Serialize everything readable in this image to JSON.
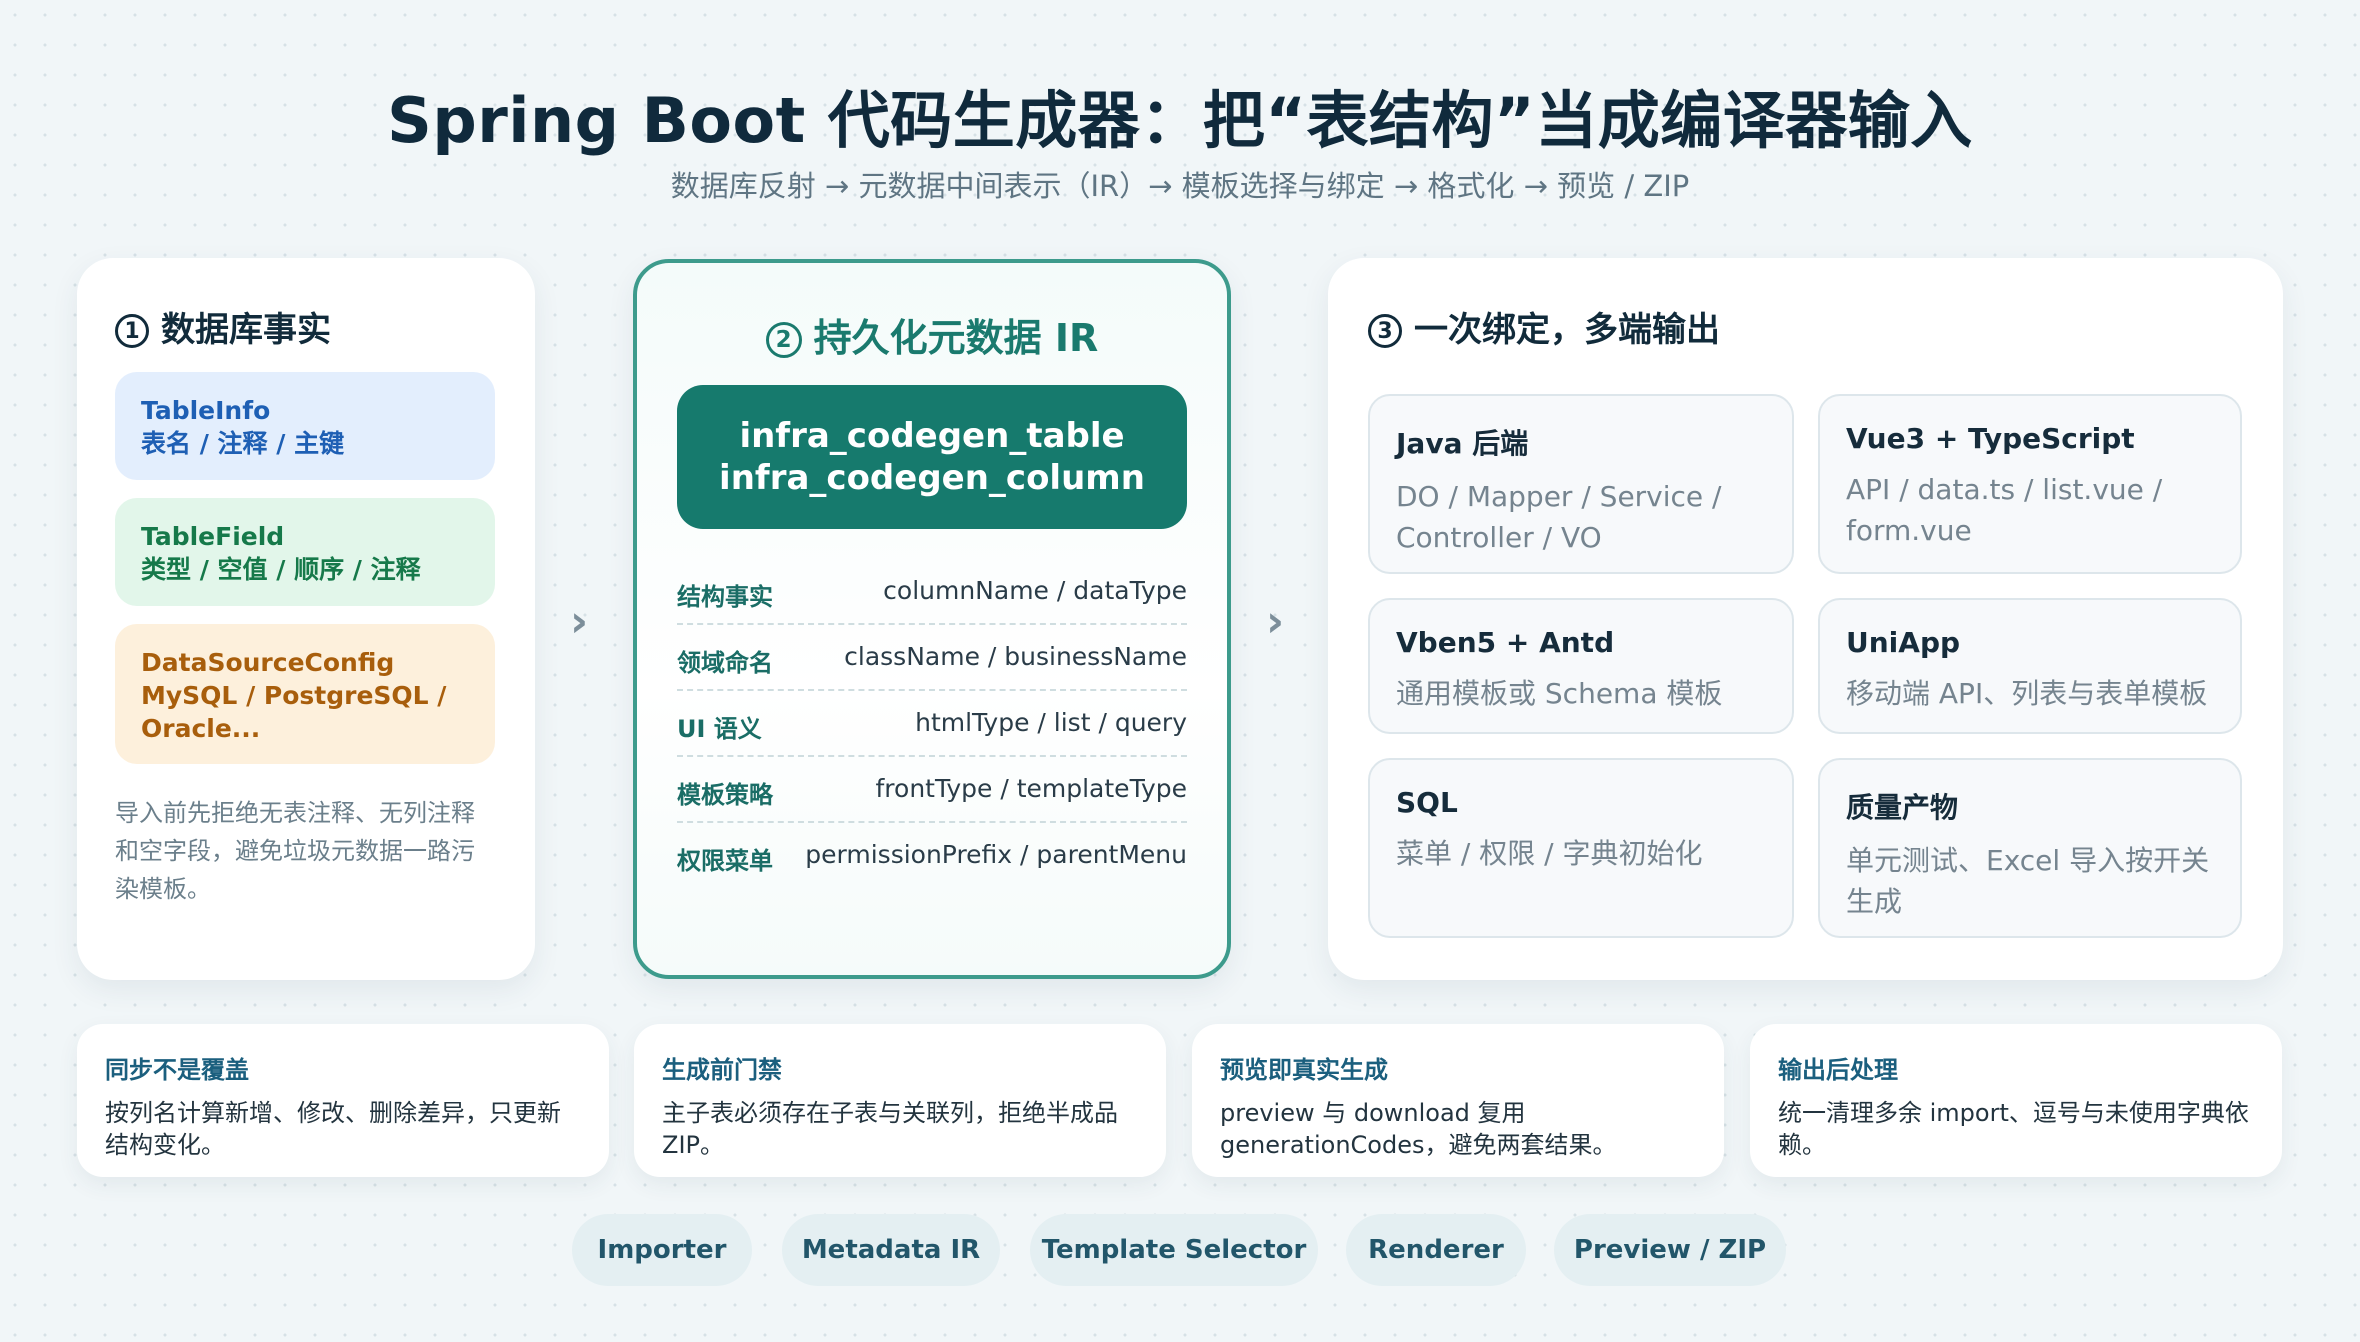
{
  "header": {
    "title": "Spring Boot 代码生成器：把“表结构”当成编译器输入",
    "subtitle": "数据库反射 → 元数据中间表示（IR）→ 模板选择与绑定 → 格式化 → 预览 / ZIP"
  },
  "left": {
    "num": "1",
    "title": "数据库事实",
    "pills": [
      {
        "line1": "TableInfo",
        "line2": "表名 / 注释 / 主键"
      },
      {
        "line1": "TableField",
        "line2": "类型 / 空值 / 顺序 / 注释"
      },
      {
        "line1": "DataSourceConfig",
        "line2": "MySQL / PostgreSQL /",
        "line3": "Oracle..."
      }
    ],
    "note": "导入前先拒绝无表注释、无列注释和空字段，避免垃圾元数据一路污染模板。"
  },
  "arrows": {
    "a1": "›",
    "a2": "›"
  },
  "middle": {
    "num": "2",
    "title": "持久化元数据 IR",
    "banner_line1": "infra_codegen_table",
    "banner_line2": "infra_codegen_column",
    "rows": [
      {
        "key": "结构事实",
        "value": "columnName / dataType"
      },
      {
        "key": "领域命名",
        "value": "className / businessName"
      },
      {
        "key": "UI 语义",
        "value": "htmlType / list / query"
      },
      {
        "key": "模板策略",
        "value": "frontType / templateType"
      },
      {
        "key": "权限菜单",
        "value": "permissionPrefix / parentMenu"
      }
    ]
  },
  "right": {
    "num": "3",
    "title": "一次绑定，多端输出",
    "tiles": [
      {
        "title": "Java 后端",
        "desc": "DO / Mapper / Service / Controller / VO"
      },
      {
        "title": "Vue3 + TypeScript",
        "desc": "API / data.ts / list.vue / form.vue"
      },
      {
        "title": "Vben5 + Antd",
        "desc": "通用模板或 Schema 模板"
      },
      {
        "title": "UniApp",
        "desc": "移动端 API、列表与表单模板"
      },
      {
        "title": "SQL",
        "desc": "菜单 / 权限 / 字典初始化"
      },
      {
        "title": "质量产物",
        "desc": "单元测试、Excel 导入按开关生成"
      }
    ]
  },
  "footer_cards": [
    {
      "title": "同步不是覆盖",
      "desc": "按列名计算新增、修改、删除差异，只更新结构变化。"
    },
    {
      "title": "生成前门禁",
      "desc": "主子表必须存在子表与关联列，拒绝半成品 ZIP。"
    },
    {
      "title": "预览即真实生成",
      "desc": "preview 与 download 复用 generationCodes，避免两套结果。"
    },
    {
      "title": "输出后处理",
      "desc": "统一清理多余 import、逗号与未使用字典依赖。"
    }
  ],
  "pipeline": [
    "Importer",
    "Metadata IR",
    "Template Selector",
    "Renderer",
    "Preview / ZIP"
  ],
  "colors": {
    "accent_teal": "#167a6d",
    "blue_text": "#1e5fb4",
    "green_text": "#16794a",
    "orange_text": "#a85e0c"
  }
}
